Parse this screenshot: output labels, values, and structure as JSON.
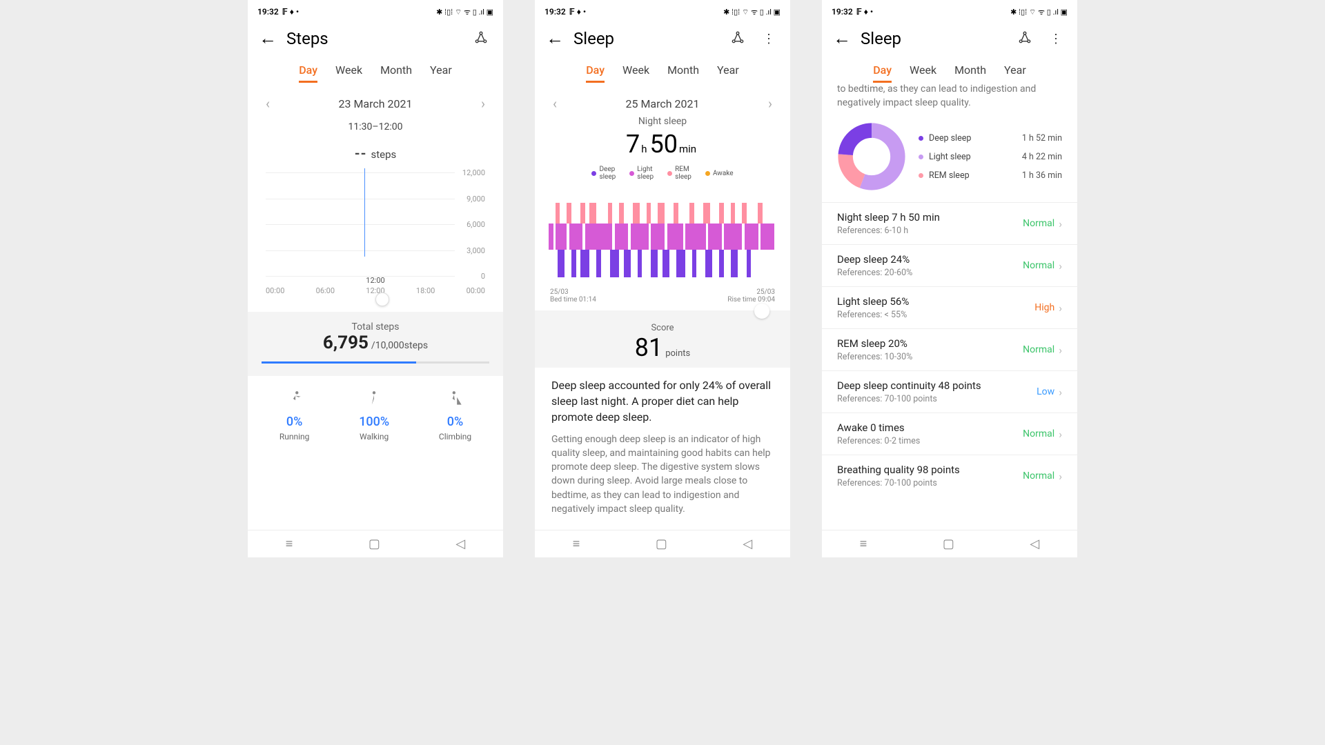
{
  "status": {
    "time": "19:32",
    "icons_left": "𝔽 ♦ •",
    "icons_right": "✱ ⁞▯⁞ ⌔ ᯤ ▯ .ıl ▣"
  },
  "tabs": [
    "Day",
    "Week",
    "Month",
    "Year"
  ],
  "s1": {
    "title": "Steps",
    "date": "23 March 2021",
    "time_window": "11:30–12:00",
    "steps_value": "--",
    "steps_unit": "steps",
    "total_label": "Total steps",
    "total_value": "6,795",
    "goal": "/10,000steps",
    "activities": [
      {
        "name": "Running",
        "pct": "0%",
        "icon": "run"
      },
      {
        "name": "Walking",
        "pct": "100%",
        "icon": "walk"
      },
      {
        "name": "Climbing",
        "pct": "0%",
        "icon": "climb"
      }
    ],
    "xaxis": [
      "00:00",
      "06:00",
      "12:00",
      "18:00",
      "00:00"
    ]
  },
  "s2": {
    "title": "Sleep",
    "date": "25 March 2021",
    "subtitle": "Night sleep",
    "dur_h": "7",
    "dur_h_u": "h",
    "dur_m": "50",
    "dur_m_u": "min",
    "legend": [
      {
        "name": "Deep\nsleep",
        "color": "#7b3fe4"
      },
      {
        "name": "Light\nsleep",
        "color": "#d65ad6"
      },
      {
        "name": "REM\nsleep",
        "color": "#ff8fa1"
      },
      {
        "name": "Awake",
        "color": "#f5a623"
      }
    ],
    "bed_date": "25/03",
    "bed_label": "Bed time 01:14",
    "rise_date": "25/03",
    "rise_label": "Rise time 09:04",
    "score_label": "Score",
    "score": "81",
    "score_unit": "points",
    "advice_main": "Deep sleep accounted for only 24% of overall sleep last night. A proper diet can help promote deep sleep.",
    "advice_sub": "Getting enough deep sleep is an indicator of high quality sleep, and maintaining good habits can help promote deep sleep. The digestive system slows down during sleep. Avoid large meals close to bedtime, as they can lead to indigestion and negatively impact sleep quality."
  },
  "s3": {
    "title": "Sleep",
    "truncated": "to bedtime, as they can lead to indigestion and negatively impact sleep quality.",
    "donut_legend": [
      {
        "name": "Deep sleep",
        "time": "1 h 52 min",
        "color": "#7b3fe4"
      },
      {
        "name": "Light sleep",
        "time": "4 h 22 min",
        "color": "#c79bf2"
      },
      {
        "name": "REM sleep",
        "time": "1 h 36 min",
        "color": "#ff9aa8"
      }
    ],
    "metrics": [
      {
        "t": "Night sleep  7 h 50 min",
        "r": "References: 6-10 h",
        "s": "Normal",
        "cls": "st-normal"
      },
      {
        "t": "Deep sleep  24%",
        "r": "References: 20-60%",
        "s": "Normal",
        "cls": "st-normal"
      },
      {
        "t": "Light sleep  56%",
        "r": "References: < 55%",
        "s": "High",
        "cls": "st-high"
      },
      {
        "t": "REM sleep  20%",
        "r": "References: 10-30%",
        "s": "Normal",
        "cls": "st-normal"
      },
      {
        "t": "Deep sleep continuity  48 points",
        "r": "References: 70-100 points",
        "s": "Low",
        "cls": "st-low"
      },
      {
        "t": "Awake  0 times",
        "r": "References: 0-2 times",
        "s": "Normal",
        "cls": "st-normal"
      },
      {
        "t": "Breathing quality  98 points",
        "r": "References: 70-100 points",
        "s": "Normal",
        "cls": "st-normal"
      }
    ]
  },
  "chart_data": {
    "steps_axis": {
      "type": "bar",
      "ylim": [
        0,
        12000
      ],
      "yticks": [
        0,
        3000,
        6000,
        9000,
        12000
      ],
      "xticks": [
        "00:00",
        "06:00",
        "12:00",
        "18:00",
        "00:00"
      ],
      "cursor_label": "12:00"
    },
    "sleep_donut": {
      "type": "pie",
      "series": [
        {
          "name": "Deep sleep",
          "value": 112,
          "color": "#7b3fe4"
        },
        {
          "name": "Light sleep",
          "value": 262,
          "color": "#c79bf2"
        },
        {
          "name": "REM sleep",
          "value": 96,
          "color": "#ff9aa8"
        }
      ],
      "unit": "minutes"
    },
    "sleep_stages": {
      "type": "area",
      "x_range": [
        "01:14",
        "09:04"
      ],
      "levels": [
        "Awake",
        "REM",
        "Light",
        "Deep"
      ]
    }
  }
}
